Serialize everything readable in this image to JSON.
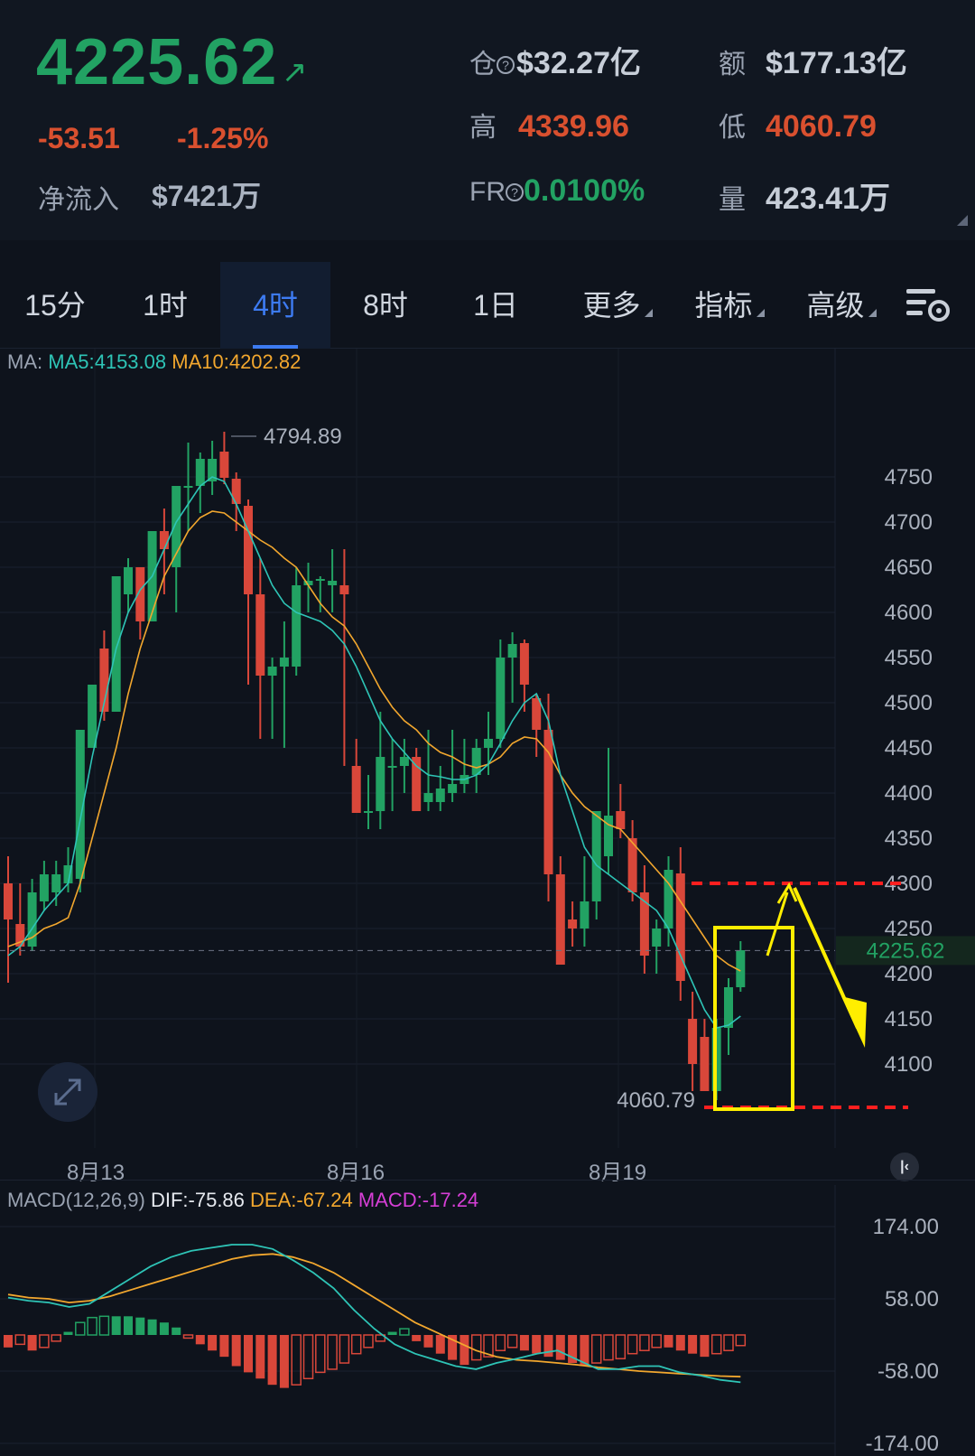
{
  "header": {
    "price": "4225.62",
    "change": "-53.51",
    "change_pct": "-1.25%",
    "net_inflow_label": "净流入",
    "net_inflow_value": "$7421万",
    "oi_label": "仓",
    "oi_value": "$32.27亿",
    "amount_label": "额",
    "amount_value": "$177.13亿",
    "high_label": "高",
    "high_value": "4339.96",
    "low_label": "低",
    "low_value": "4060.79",
    "fr_label": "FR",
    "fr_value": "0.0100%",
    "vol_label": "量",
    "vol_value": "423.41万"
  },
  "tabs": [
    {
      "label": "15分"
    },
    {
      "label": "1时"
    },
    {
      "label": "4时",
      "active": true
    },
    {
      "label": "8时"
    },
    {
      "label": "1日"
    },
    {
      "label": "更多"
    },
    {
      "label": "指标"
    },
    {
      "label": "高级"
    }
  ],
  "ma_legend": {
    "prefix": "MA:",
    "ma5": "MA5:4153.08",
    "ma10": "MA10:4202.82"
  },
  "macd_legend": {
    "prefix": "MACD(12,26,9)",
    "dif": "DIF:-75.86",
    "dea": "DEA:-67.24",
    "macd": "MACD:-17.24"
  },
  "colors": {
    "up": "#22a263",
    "down": "#d9473a",
    "ma5": "#2ec4b6",
    "ma10": "#f2a72e",
    "annotation": "#ffee00",
    "dashed_red": "#ff1f1f"
  },
  "chart_data": [
    {
      "type": "candlestick",
      "x_labels": [
        "8月13",
        "8月16",
        "8月19"
      ],
      "y_ticks": [
        4750,
        4700,
        4650,
        4600,
        4550,
        4500,
        4450,
        4400,
        4350,
        4300,
        4250,
        4200,
        4150,
        4100
      ],
      "current_price": "4225.62",
      "max_label": "4794.89",
      "min_label": "4060.79",
      "candles": [
        [
          4300,
          4330,
          4190,
          4260
        ],
        [
          4255,
          4300,
          4220,
          4230
        ],
        [
          4230,
          4305,
          4225,
          4290
        ],
        [
          4280,
          4325,
          4270,
          4310
        ],
        [
          4290,
          4325,
          4275,
          4310
        ],
        [
          4300,
          4340,
          4290,
          4320
        ],
        [
          4305,
          4470,
          4290,
          4470
        ],
        [
          4450,
          4520,
          4450,
          4520
        ],
        [
          4560,
          4580,
          4480,
          4490
        ],
        [
          4490,
          4640,
          4490,
          4640
        ],
        [
          4620,
          4660,
          4600,
          4650
        ],
        [
          4650,
          4600,
          4570,
          4590
        ],
        [
          4590,
          4690,
          4590,
          4690
        ],
        [
          4690,
          4715,
          4620,
          4670
        ],
        [
          4650,
          4740,
          4600,
          4740
        ],
        [
          4740,
          4788,
          4690,
          4740
        ],
        [
          4740,
          4777,
          4710,
          4770
        ],
        [
          4745,
          4790,
          4730,
          4770
        ],
        [
          4778,
          4800,
          4742,
          4749
        ],
        [
          4748,
          4755,
          4690,
          4720
        ],
        [
          4718,
          4725,
          4520,
          4620
        ],
        [
          4620,
          4660,
          4460,
          4530
        ],
        [
          4530,
          4550,
          4460,
          4540
        ],
        [
          4540,
          4590,
          4450,
          4550
        ],
        [
          4540,
          4650,
          4530,
          4630
        ],
        [
          4630,
          4655,
          4600,
          4635
        ],
        [
          4635,
          4640,
          4600,
          4637
        ],
        [
          4630,
          4670,
          4600,
          4635
        ],
        [
          4630,
          4670,
          4430,
          4620
        ],
        [
          4430,
          4460,
          4380,
          4378
        ],
        [
          4380,
          4420,
          4360,
          4380
        ],
        [
          4380,
          4490,
          4360,
          4440
        ],
        [
          4430,
          4460,
          4380,
          4430
        ],
        [
          4430,
          4460,
          4400,
          4440
        ],
        [
          4440,
          4450,
          4380,
          4380
        ],
        [
          4390,
          4470,
          4380,
          4400
        ],
        [
          4390,
          4430,
          4380,
          4405
        ],
        [
          4400,
          4470,
          4390,
          4410
        ],
        [
          4410,
          4460,
          4400,
          4420
        ],
        [
          4420,
          4460,
          4400,
          4450
        ],
        [
          4450,
          4490,
          4420,
          4460
        ],
        [
          4460,
          4570,
          4450,
          4550
        ],
        [
          4550,
          4578,
          4500,
          4565
        ],
        [
          4566,
          4570,
          4490,
          4520
        ],
        [
          4505,
          4510,
          4440,
          4470
        ],
        [
          4470,
          4510,
          4280,
          4310
        ],
        [
          4310,
          4330,
          4240,
          4210
        ],
        [
          4260,
          4280,
          4230,
          4250
        ],
        [
          4250,
          4330,
          4230,
          4280
        ],
        [
          4280,
          4380,
          4260,
          4380
        ],
        [
          4330,
          4450,
          4310,
          4375
        ],
        [
          4380,
          4410,
          4350,
          4360
        ],
        [
          4350,
          4370,
          4280,
          4290
        ],
        [
          4290,
          4320,
          4200,
          4220
        ],
        [
          4230,
          4260,
          4200,
          4250
        ],
        [
          4250,
          4330,
          4230,
          4315
        ],
        [
          4311,
          4340,
          4170,
          4192
        ],
        [
          4150,
          4180,
          4070,
          4100
        ],
        [
          4130,
          4150,
          4070,
          4070
        ],
        [
          4070,
          4150,
          4060,
          4140
        ],
        [
          4140,
          4195,
          4110,
          4185
        ],
        [
          4185,
          4236,
          4180,
          4226
        ]
      ],
      "ma5": [
        4220,
        4230,
        4250,
        4270,
        4285,
        4300,
        4370,
        4440,
        4500,
        4560,
        4600,
        4625,
        4640,
        4670,
        4700,
        4720,
        4740,
        4750,
        4745,
        4720,
        4690,
        4660,
        4630,
        4610,
        4600,
        4595,
        4590,
        4580,
        4565,
        4540,
        4510,
        4480,
        4460,
        4445,
        4430,
        4420,
        4418,
        4415,
        4415,
        4420,
        4432,
        4455,
        4480,
        4500,
        4510,
        4480,
        4420,
        4380,
        4340,
        4320,
        4310,
        4300,
        4290,
        4280,
        4270,
        4250,
        4220,
        4190,
        4160,
        4140,
        4143,
        4153
      ],
      "ma10": [
        4230,
        4235,
        4240,
        4250,
        4255,
        4262,
        4300,
        4350,
        4400,
        4450,
        4510,
        4560,
        4600,
        4640,
        4665,
        4690,
        4705,
        4712,
        4710,
        4700,
        4690,
        4680,
        4672,
        4660,
        4650,
        4630,
        4610,
        4595,
        4585,
        4565,
        4540,
        4515,
        4495,
        4480,
        4470,
        4455,
        4445,
        4440,
        4432,
        4428,
        4432,
        4440,
        4455,
        4462,
        4460,
        4445,
        4420,
        4400,
        4385,
        4375,
        4365,
        4360,
        4345,
        4330,
        4315,
        4300,
        4280,
        4260,
        4240,
        4220,
        4210,
        4203
      ],
      "annotation": {
        "box_from_price": 4060,
        "box_to_price": 4255,
        "red_dashed_top": 4300,
        "red_dashed_bottom": 4060
      }
    },
    {
      "type": "macd",
      "y_ticks": [
        "174.00",
        "58.00",
        "-58.00",
        "-174.00"
      ],
      "dif": [
        60,
        55,
        52,
        45,
        50,
        70,
        90,
        110,
        125,
        135,
        140,
        145,
        145,
        138,
        120,
        100,
        75,
        40,
        10,
        -15,
        -30,
        -40,
        -50,
        -55,
        -45,
        -38,
        -30,
        -25,
        -40,
        -55,
        -55,
        -50,
        -50,
        -60,
        -65,
        -72,
        -76
      ],
      "dea": [
        65,
        60,
        58,
        52,
        55,
        62,
        72,
        82,
        92,
        102,
        112,
        122,
        128,
        130,
        125,
        115,
        100,
        80,
        60,
        40,
        20,
        5,
        -10,
        -25,
        -35,
        -40,
        -42,
        -45,
        -48,
        -52,
        -55,
        -58,
        -60,
        -62,
        -64,
        -66,
        -67
      ],
      "hist": [
        -20,
        -15,
        -25,
        -20,
        -10,
        5,
        20,
        28,
        30,
        30,
        30,
        28,
        25,
        20,
        12,
        -5,
        -15,
        -25,
        -35,
        -50,
        -60,
        -70,
        -80,
        -85,
        -80,
        -70,
        -60,
        -55,
        -45,
        -30,
        -20,
        -10,
        5,
        10,
        -10,
        -20,
        -30,
        -40,
        -48,
        -40,
        -35,
        -25,
        -20,
        -25,
        -30,
        -35,
        -40,
        -45,
        -50,
        -45,
        -40,
        -38,
        -30,
        -25,
        -20,
        -20,
        -25,
        -30,
        -35,
        -30,
        -25,
        -17
      ]
    }
  ]
}
